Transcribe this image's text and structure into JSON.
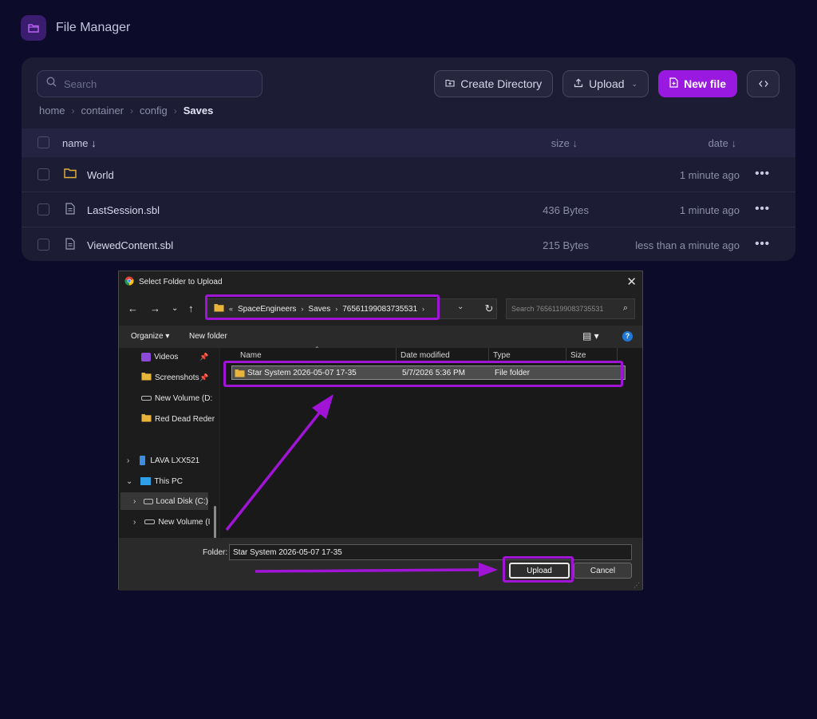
{
  "app": {
    "title": "File Manager"
  },
  "search": {
    "placeholder": "Search"
  },
  "toolbar": {
    "create_directory": "Create Directory",
    "upload": "Upload",
    "new_file": "New file"
  },
  "breadcrumb": [
    "home",
    "container",
    "config",
    "Saves"
  ],
  "table": {
    "headers": {
      "name": "name ↓",
      "size": "size ↓",
      "date": "date ↓"
    },
    "rows": [
      {
        "name": "World",
        "type": "folder",
        "size": "",
        "date": "1 minute ago"
      },
      {
        "name": "LastSession.sbl",
        "type": "file",
        "size": "436 Bytes",
        "date": "1 minute ago"
      },
      {
        "name": "ViewedContent.sbl",
        "type": "file",
        "size": "215 Bytes",
        "date": "less than a minute ago"
      }
    ]
  },
  "dialog": {
    "title": "Select Folder to Upload",
    "address": {
      "overflow": "«",
      "segments": [
        "SpaceEngineers",
        "Saves",
        "76561199083735531"
      ]
    },
    "search_placeholder": "Search 76561199083735531",
    "commands": {
      "organize": "Organize ▾",
      "new_folder": "New folder"
    },
    "nav_items": [
      {
        "label": "Videos",
        "icon": "videos-icon",
        "pinned": true
      },
      {
        "label": "Screenshots",
        "icon": "folder-icon",
        "pinned": true
      },
      {
        "label": "New Volume (D:",
        "icon": "drive-icon",
        "pinned": false
      },
      {
        "label": "Red Dead Reder",
        "icon": "folder-icon",
        "pinned": false
      },
      {
        "label": "LAVA LXX521",
        "icon": "phone-icon",
        "pinned": false
      },
      {
        "label": "This PC",
        "icon": "pc-icon",
        "pinned": false
      },
      {
        "label": "Local Disk (C:)",
        "icon": "drive-icon",
        "pinned": false
      },
      {
        "label": "New Volume (I",
        "icon": "drive-icon",
        "pinned": false
      }
    ],
    "columns": {
      "name": "Name",
      "date_modified": "Date modified",
      "type": "Type",
      "size": "Size"
    },
    "files": [
      {
        "name": "Star System 2026-05-07 17-35",
        "date_modified": "5/7/2026 5:36 PM",
        "type": "File folder",
        "size": ""
      }
    ],
    "folder_label": "Folder:",
    "folder_value": "Star System 2026-05-07 17-35",
    "buttons": {
      "upload": "Upload",
      "cancel": "Cancel"
    }
  },
  "colors": {
    "accent": "#9a19e0",
    "annotation": "#a014d6",
    "background": "#0c0c2a"
  }
}
